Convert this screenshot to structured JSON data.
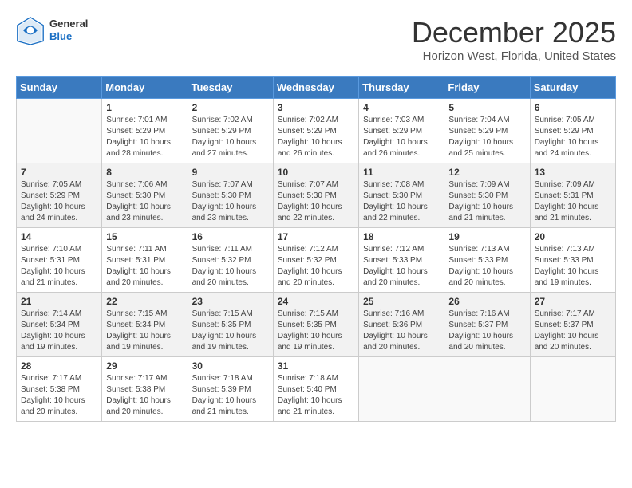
{
  "header": {
    "logo_general": "General",
    "logo_blue": "Blue",
    "month_title": "December 2025",
    "location": "Horizon West, Florida, United States"
  },
  "days_of_week": [
    "Sunday",
    "Monday",
    "Tuesday",
    "Wednesday",
    "Thursday",
    "Friday",
    "Saturday"
  ],
  "weeks": [
    [
      {
        "day": "",
        "info": ""
      },
      {
        "day": "1",
        "info": "Sunrise: 7:01 AM\nSunset: 5:29 PM\nDaylight: 10 hours\nand 28 minutes."
      },
      {
        "day": "2",
        "info": "Sunrise: 7:02 AM\nSunset: 5:29 PM\nDaylight: 10 hours\nand 27 minutes."
      },
      {
        "day": "3",
        "info": "Sunrise: 7:02 AM\nSunset: 5:29 PM\nDaylight: 10 hours\nand 26 minutes."
      },
      {
        "day": "4",
        "info": "Sunrise: 7:03 AM\nSunset: 5:29 PM\nDaylight: 10 hours\nand 26 minutes."
      },
      {
        "day": "5",
        "info": "Sunrise: 7:04 AM\nSunset: 5:29 PM\nDaylight: 10 hours\nand 25 minutes."
      },
      {
        "day": "6",
        "info": "Sunrise: 7:05 AM\nSunset: 5:29 PM\nDaylight: 10 hours\nand 24 minutes."
      }
    ],
    [
      {
        "day": "7",
        "info": "Sunrise: 7:05 AM\nSunset: 5:29 PM\nDaylight: 10 hours\nand 24 minutes."
      },
      {
        "day": "8",
        "info": "Sunrise: 7:06 AM\nSunset: 5:30 PM\nDaylight: 10 hours\nand 23 minutes."
      },
      {
        "day": "9",
        "info": "Sunrise: 7:07 AM\nSunset: 5:30 PM\nDaylight: 10 hours\nand 23 minutes."
      },
      {
        "day": "10",
        "info": "Sunrise: 7:07 AM\nSunset: 5:30 PM\nDaylight: 10 hours\nand 22 minutes."
      },
      {
        "day": "11",
        "info": "Sunrise: 7:08 AM\nSunset: 5:30 PM\nDaylight: 10 hours\nand 22 minutes."
      },
      {
        "day": "12",
        "info": "Sunrise: 7:09 AM\nSunset: 5:30 PM\nDaylight: 10 hours\nand 21 minutes."
      },
      {
        "day": "13",
        "info": "Sunrise: 7:09 AM\nSunset: 5:31 PM\nDaylight: 10 hours\nand 21 minutes."
      }
    ],
    [
      {
        "day": "14",
        "info": "Sunrise: 7:10 AM\nSunset: 5:31 PM\nDaylight: 10 hours\nand 21 minutes."
      },
      {
        "day": "15",
        "info": "Sunrise: 7:11 AM\nSunset: 5:31 PM\nDaylight: 10 hours\nand 20 minutes."
      },
      {
        "day": "16",
        "info": "Sunrise: 7:11 AM\nSunset: 5:32 PM\nDaylight: 10 hours\nand 20 minutes."
      },
      {
        "day": "17",
        "info": "Sunrise: 7:12 AM\nSunset: 5:32 PM\nDaylight: 10 hours\nand 20 minutes."
      },
      {
        "day": "18",
        "info": "Sunrise: 7:12 AM\nSunset: 5:33 PM\nDaylight: 10 hours\nand 20 minutes."
      },
      {
        "day": "19",
        "info": "Sunrise: 7:13 AM\nSunset: 5:33 PM\nDaylight: 10 hours\nand 20 minutes."
      },
      {
        "day": "20",
        "info": "Sunrise: 7:13 AM\nSunset: 5:33 PM\nDaylight: 10 hours\nand 19 minutes."
      }
    ],
    [
      {
        "day": "21",
        "info": "Sunrise: 7:14 AM\nSunset: 5:34 PM\nDaylight: 10 hours\nand 19 minutes."
      },
      {
        "day": "22",
        "info": "Sunrise: 7:15 AM\nSunset: 5:34 PM\nDaylight: 10 hours\nand 19 minutes."
      },
      {
        "day": "23",
        "info": "Sunrise: 7:15 AM\nSunset: 5:35 PM\nDaylight: 10 hours\nand 19 minutes."
      },
      {
        "day": "24",
        "info": "Sunrise: 7:15 AM\nSunset: 5:35 PM\nDaylight: 10 hours\nand 19 minutes."
      },
      {
        "day": "25",
        "info": "Sunrise: 7:16 AM\nSunset: 5:36 PM\nDaylight: 10 hours\nand 20 minutes."
      },
      {
        "day": "26",
        "info": "Sunrise: 7:16 AM\nSunset: 5:37 PM\nDaylight: 10 hours\nand 20 minutes."
      },
      {
        "day": "27",
        "info": "Sunrise: 7:17 AM\nSunset: 5:37 PM\nDaylight: 10 hours\nand 20 minutes."
      }
    ],
    [
      {
        "day": "28",
        "info": "Sunrise: 7:17 AM\nSunset: 5:38 PM\nDaylight: 10 hours\nand 20 minutes."
      },
      {
        "day": "29",
        "info": "Sunrise: 7:17 AM\nSunset: 5:38 PM\nDaylight: 10 hours\nand 20 minutes."
      },
      {
        "day": "30",
        "info": "Sunrise: 7:18 AM\nSunset: 5:39 PM\nDaylight: 10 hours\nand 21 minutes."
      },
      {
        "day": "31",
        "info": "Sunrise: 7:18 AM\nSunset: 5:40 PM\nDaylight: 10 hours\nand 21 minutes."
      },
      {
        "day": "",
        "info": ""
      },
      {
        "day": "",
        "info": ""
      },
      {
        "day": "",
        "info": ""
      }
    ]
  ]
}
